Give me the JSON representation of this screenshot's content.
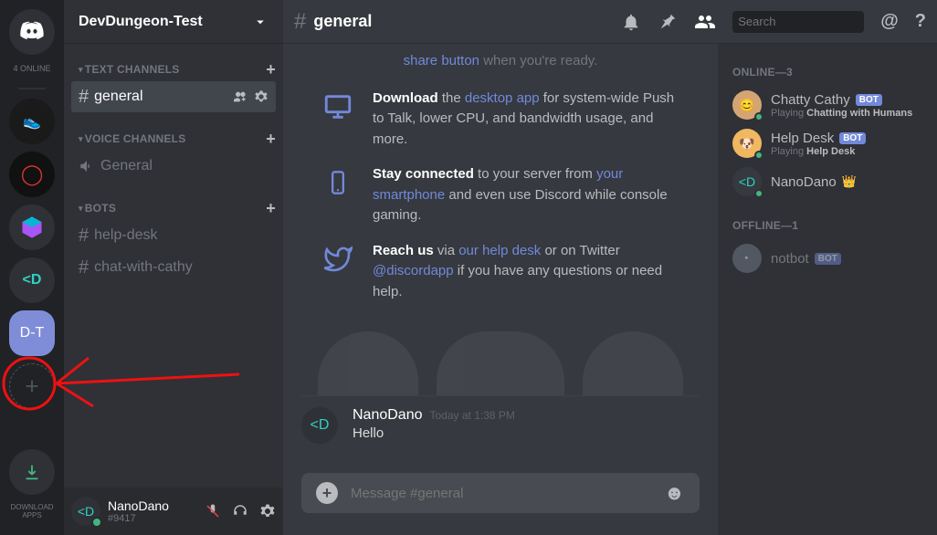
{
  "servers": {
    "online_label": "4 ONLINE",
    "list": [
      {
        "id": "boot",
        "letter": ""
      },
      {
        "id": "circle",
        "letter": ""
      },
      {
        "id": "cube",
        "letter": ""
      },
      {
        "id": "dlogo",
        "letter": "<D"
      },
      {
        "id": "dt",
        "letter": "D-T"
      }
    ],
    "download_label": "DOWNLOAD\nAPPS"
  },
  "guild": {
    "name": "DevDungeon-Test",
    "categories": [
      {
        "name": "TEXT CHANNELS",
        "has_add": true,
        "channels": [
          {
            "name": "general",
            "type": "text",
            "selected": true
          }
        ]
      },
      {
        "name": "VOICE CHANNELS",
        "has_add": true,
        "channels": [
          {
            "name": "General",
            "type": "voice"
          }
        ]
      },
      {
        "name": "BOTS",
        "has_add": true,
        "channels": [
          {
            "name": "help-desk",
            "type": "text"
          },
          {
            "name": "chat-with-cathy",
            "type": "text"
          }
        ]
      }
    ]
  },
  "userbar": {
    "name": "NanoDano",
    "tag": "#9417"
  },
  "topbar": {
    "channel": "general",
    "search_placeholder": "Search"
  },
  "welcome": {
    "partial_link": "share button",
    "partial_rest": " when you're ready.",
    "tips": [
      {
        "icon": "monitor",
        "bold": "Download",
        "rest1": " the ",
        "link1": "desktop app",
        "rest2": " for system-wide Push to Talk, lower CPU, and bandwidth usage, and more."
      },
      {
        "icon": "phone",
        "bold": "Stay connected",
        "rest1": " to your server from ",
        "link1": "your smartphone",
        "rest2": " and even use Discord while console gaming."
      },
      {
        "icon": "twitter",
        "bold": "Reach us",
        "rest1": " via ",
        "link1": "our help desk",
        "rest2": " or on Twitter ",
        "link2": "@discordapp",
        "rest3": " if you have any questions or need help."
      }
    ]
  },
  "messages": [
    {
      "author": "NanoDano",
      "time": "Today at 1:38 PM",
      "text": "Hello"
    }
  ],
  "input": {
    "placeholder": "Message #general"
  },
  "members": {
    "online_header": "ONLINE—3",
    "online": [
      {
        "name": "Chatty Cathy",
        "bot": true,
        "status": "Playing ",
        "game": "Chatting with Humans"
      },
      {
        "name": "Help Desk",
        "bot": true,
        "status": "Playing ",
        "game": "Help Desk"
      },
      {
        "name": "NanoDano",
        "owner": true
      }
    ],
    "offline_header": "OFFLINE—1",
    "offline": [
      {
        "name": "notbot",
        "bot": true
      }
    ]
  }
}
